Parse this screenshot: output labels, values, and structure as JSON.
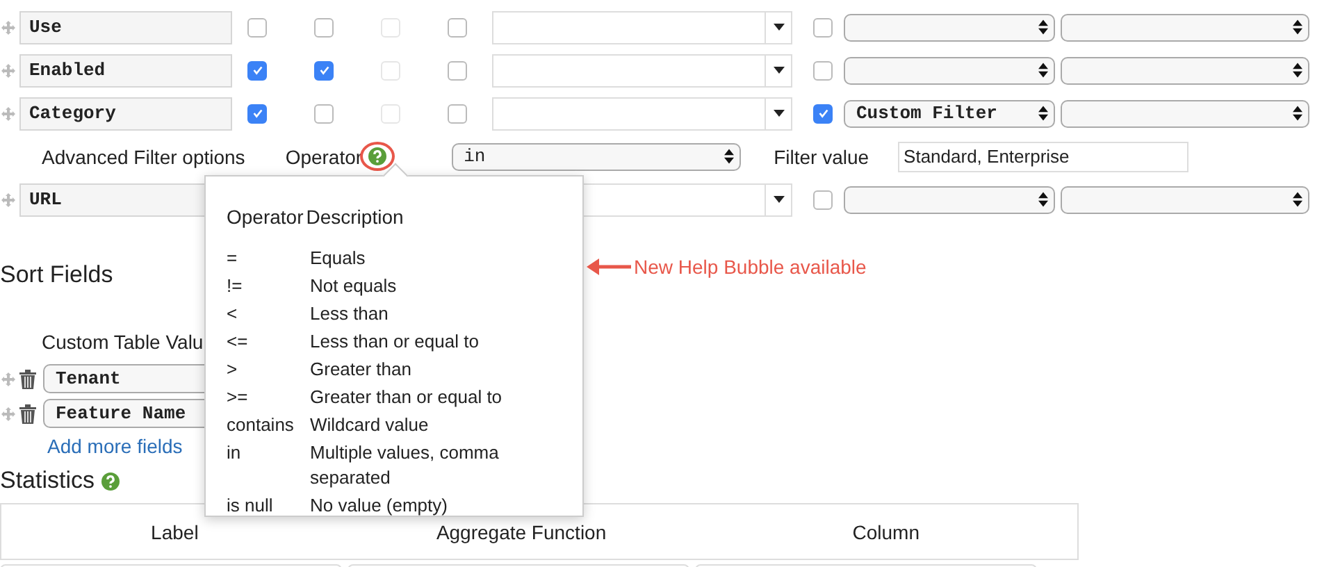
{
  "fields": [
    {
      "name": "Use",
      "checks": [
        {
          "checked": false,
          "disabled": false
        },
        {
          "checked": false,
          "disabled": false
        },
        {
          "checked": false,
          "disabled": true
        },
        {
          "checked": false,
          "disabled": false
        }
      ],
      "filter_checked": false
    },
    {
      "name": "Enabled",
      "checks": [
        {
          "checked": true,
          "disabled": false
        },
        {
          "checked": true,
          "disabled": false
        },
        {
          "checked": false,
          "disabled": true
        },
        {
          "checked": false,
          "disabled": false
        }
      ],
      "filter_checked": false
    },
    {
      "name": "Category",
      "checks": [
        {
          "checked": true,
          "disabled": false
        },
        {
          "checked": false,
          "disabled": false
        },
        {
          "checked": false,
          "disabled": true
        },
        {
          "checked": false,
          "disabled": false
        }
      ],
      "filter_checked": true,
      "filter_type": "Custom Filter",
      "advanced": {
        "label": "Advanced Filter options",
        "operator_label": "Operator",
        "operator_value": "in",
        "filter_label": "Filter value",
        "filter_value": "Standard, Enterprise"
      }
    },
    {
      "name": "URL",
      "filter_checked": false
    }
  ],
  "sort": {
    "heading": "Sort Fields",
    "sublabel": "Custom Table Valu",
    "items": [
      "Tenant",
      "Feature Name"
    ],
    "add_link": "Add more fields"
  },
  "statistics": {
    "heading": "Statistics",
    "columns": [
      "Label",
      "Aggregate Function",
      "Column"
    ]
  },
  "popover": {
    "columns": [
      "Operator",
      "Description"
    ],
    "rows": [
      {
        "operator": "=",
        "description": "Equals"
      },
      {
        "operator": "!=",
        "description": "Not equals"
      },
      {
        "operator": "<",
        "description": "Less than"
      },
      {
        "operator": "<=",
        "description": "Less than or equal to"
      },
      {
        "operator": ">",
        "description": "Greater than"
      },
      {
        "operator": ">=",
        "description": "Greater than or equal to"
      },
      {
        "operator": "contains",
        "description": "Wildcard value"
      },
      {
        "operator": "in",
        "description": "Multiple values, comma separated"
      },
      {
        "operator": "is null",
        "description": "No value (empty)"
      }
    ]
  },
  "annotation": {
    "text": "New Help Bubble available"
  }
}
